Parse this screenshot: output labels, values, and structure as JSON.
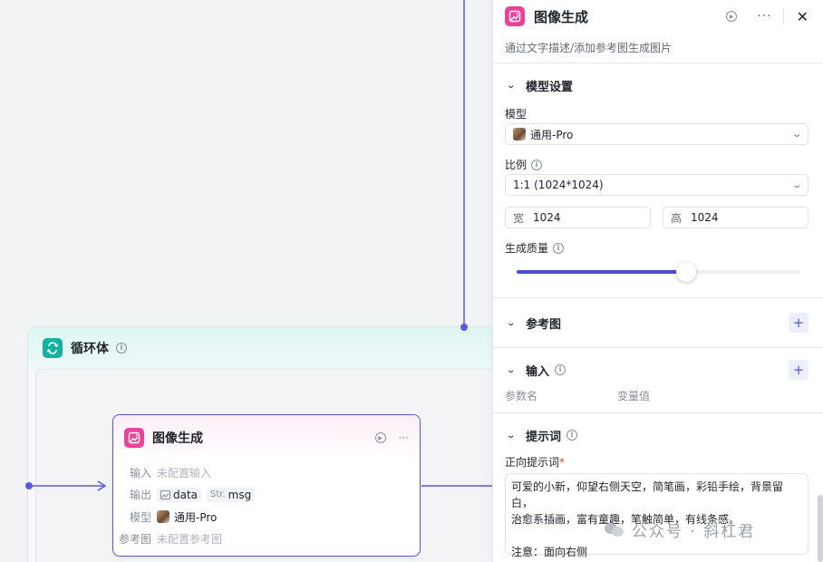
{
  "canvas": {
    "loop": {
      "title": "循环体"
    },
    "node": {
      "title": "图像生成",
      "rows": {
        "input_label": "输入",
        "input_value": "未配置输入",
        "output_label": "输出",
        "output_tags": [
          {
            "type_icon": "image-icon",
            "name": "data"
          },
          {
            "type_prefix": "Str.",
            "name": "msg"
          }
        ],
        "model_label": "模型",
        "model_value": "通用-Pro",
        "ref_label": "参考图",
        "ref_value": "未配置参考图"
      }
    }
  },
  "panel": {
    "title": "图像生成",
    "description": "通过文字描述/添加参考图生成图片",
    "model_settings": {
      "title": "模型设置",
      "model_label": "模型",
      "model_value": "通用-Pro",
      "ratio_label": "比例",
      "ratio_value": "1:1 (1024*1024)",
      "width_key": "宽",
      "width_value": "1024",
      "height_key": "高",
      "height_value": "1024",
      "quality_label": "生成质量",
      "quality_fraction": 0.6
    },
    "reference": {
      "title": "参考图"
    },
    "input": {
      "title": "输入",
      "col_param": "参数名",
      "col_var": "变量值"
    },
    "prompt": {
      "title": "提示词",
      "positive_label": "正向提示词",
      "required_mark": "*",
      "text_line1": "可爱的小新，仰望右侧天空，简笔画，彩铅手绘，背景留白，",
      "text_line2": "治愈系插画，富有童趣，笔触简单，有线条感。",
      "text_line3": "注意：面向右侧"
    }
  },
  "watermark": {
    "text": "公众号 · 斜杠君"
  },
  "colors": {
    "accent": "#5b56e0",
    "node_icon": "#e9429a",
    "loop_icon": "#16b1a0"
  }
}
